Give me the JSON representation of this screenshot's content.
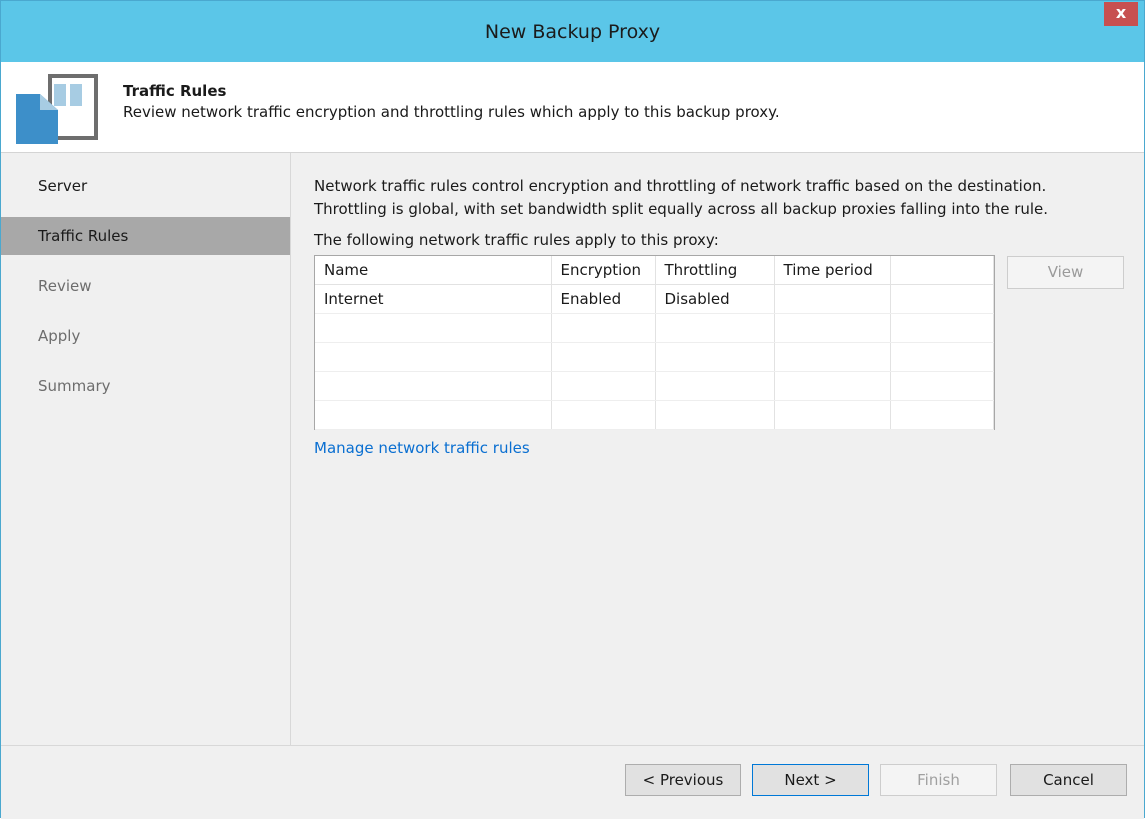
{
  "window": {
    "title": "New Backup Proxy",
    "close_label": "x"
  },
  "header": {
    "title": "Traffic Rules",
    "description": "Review network traffic encryption and throttling rules which apply to this backup proxy."
  },
  "steps": [
    {
      "label": "Server"
    },
    {
      "label": "Traffic Rules"
    },
    {
      "label": "Review"
    },
    {
      "label": "Apply"
    },
    {
      "label": "Summary"
    }
  ],
  "main": {
    "line1": "Network traffic rules control encryption and throttling of network traffic based on the destination.",
    "line2": "Throttling is global, with set bandwidth split equally across all backup proxies falling into the rule.",
    "table_caption": "The following network traffic rules apply to this proxy:",
    "columns": [
      "Name",
      "Encryption",
      "Throttling",
      "Time period"
    ],
    "rows": [
      [
        "Internet",
        "Enabled",
        "Disabled",
        ""
      ]
    ],
    "view_label": "View",
    "manage_link": "Manage network traffic rules"
  },
  "footer": {
    "previous": "< Previous",
    "next": "Next >",
    "finish": "Finish",
    "cancel": "Cancel"
  }
}
